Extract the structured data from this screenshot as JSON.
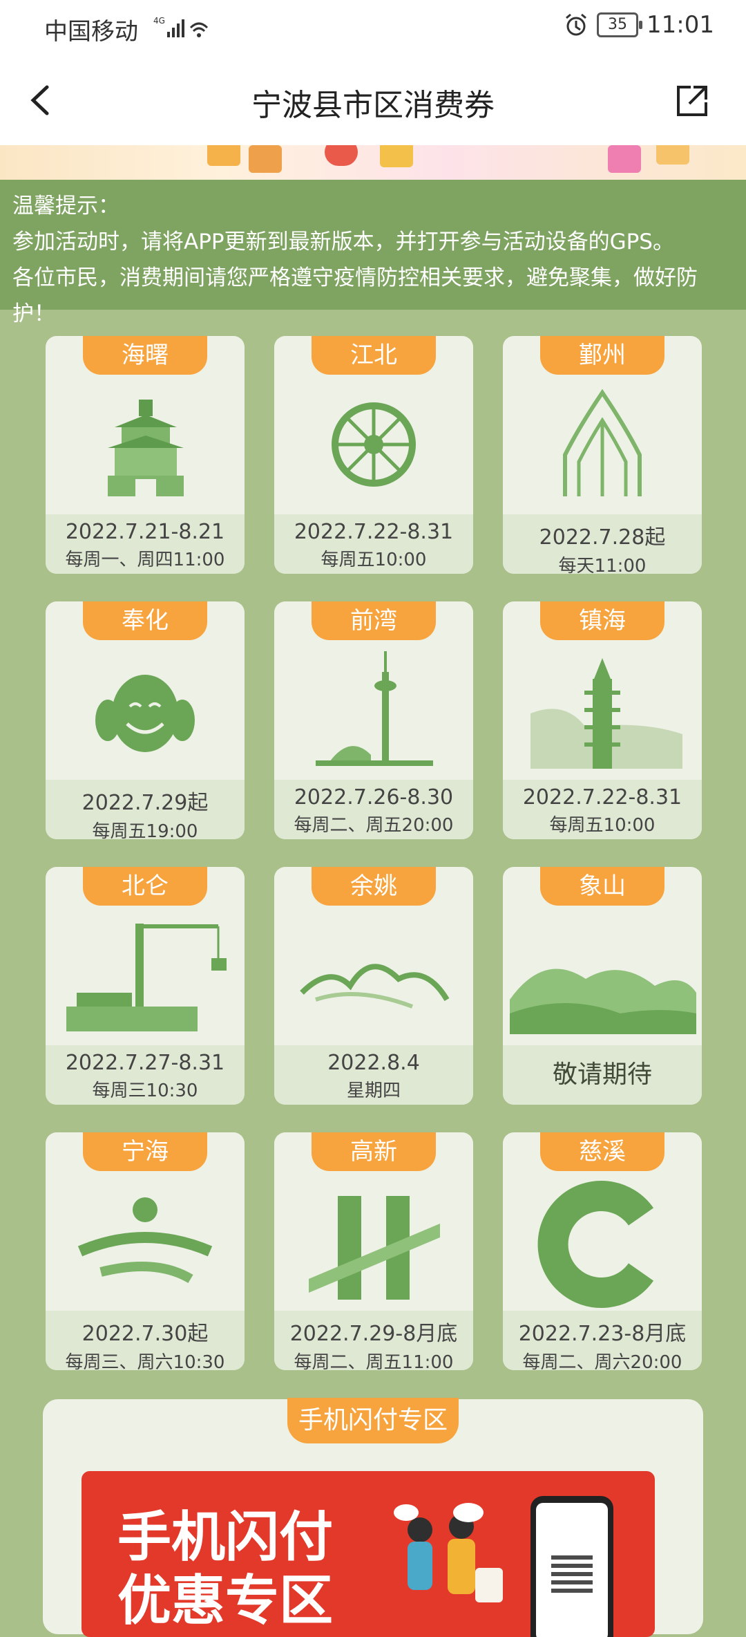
{
  "status_bar": {
    "carrier": "中国移动",
    "network": "4G",
    "battery": "35",
    "time": "11:01"
  },
  "nav": {
    "title": "宁波县市区消费券",
    "back_icon": "chevron-left-icon",
    "share_icon": "share-icon"
  },
  "notice": {
    "heading": "温馨提示：",
    "line1": "参加活动时，请将APP更新到最新版本，并打开参与活动设备的GPS。",
    "line2": "各位市民，消费期间请您严格遵守疫情防控相关要求，避免聚集，做好防护！"
  },
  "cards": [
    {
      "name": "海曙",
      "date": "2022.7.21-8.21",
      "time": "每周一、周四11:00"
    },
    {
      "name": "江北",
      "date": "2022.7.22-8.31",
      "time": "每周五10:00"
    },
    {
      "name": "鄞州",
      "date": "2022.7.28起",
      "time": "每天11:00"
    },
    {
      "name": "奉化",
      "date": "2022.7.29起",
      "time": "每周五19:00"
    },
    {
      "name": "前湾",
      "date": "2022.7.26-8.30",
      "time": "每周二、周五20:00"
    },
    {
      "name": "镇海",
      "date": "2022.7.22-8.31",
      "time": "每周五10:00"
    },
    {
      "name": "北仑",
      "date": "2022.7.27-8.31",
      "time": "每周三10:30"
    },
    {
      "name": "余姚",
      "date": "2022.8.4",
      "time": "星期四"
    },
    {
      "name": "象山",
      "soon": "敬请期待"
    },
    {
      "name": "宁海",
      "date": "2022.7.30起",
      "time": "每周三、周六10:30"
    },
    {
      "name": "高新",
      "date": "2022.7.29-8月底",
      "time": "每周二、周五11:00"
    },
    {
      "name": "慈溪",
      "date": "2022.7.23-8月底",
      "time": "每周二、周六20:00"
    }
  ],
  "flash": {
    "tag": "手机闪付专区",
    "line1": "手机闪付",
    "line2": "优惠专区"
  },
  "colors": {
    "accent_orange": "#f7a43e",
    "notice_green": "#7fa462",
    "page_green": "#a9c08a",
    "card_bg": "#eef1e6",
    "promo_red": "#e2392a"
  }
}
